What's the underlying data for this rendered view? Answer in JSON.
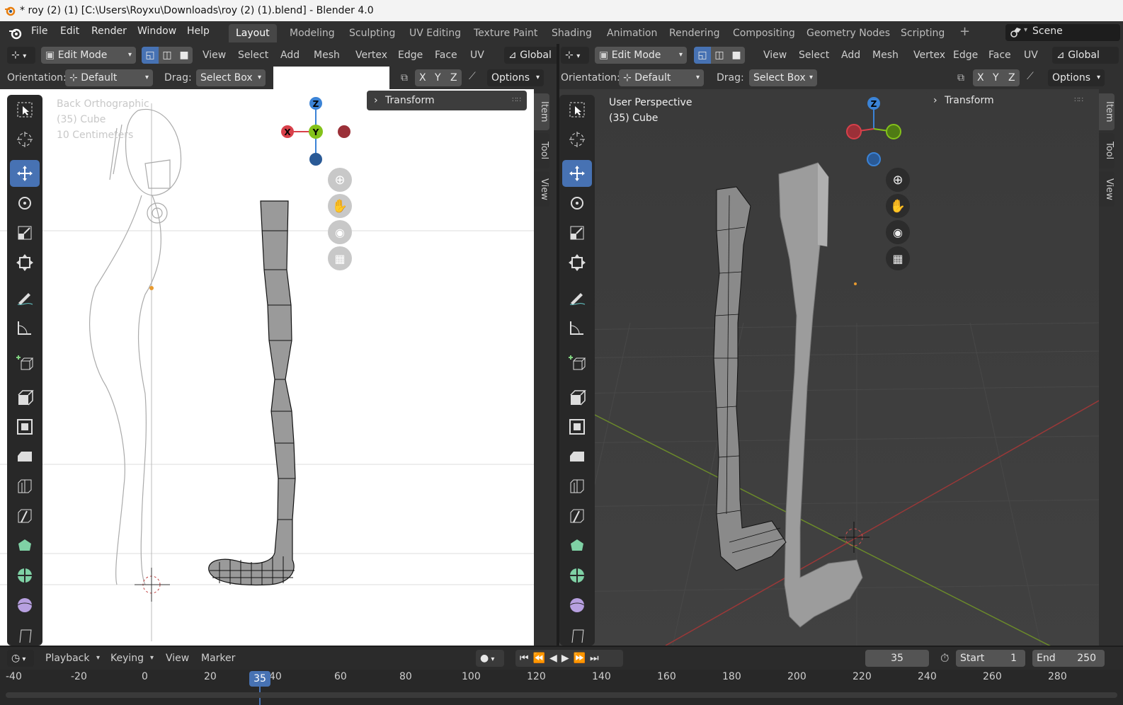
{
  "titlebar": {
    "title": "* roy (2) (1) [C:\\Users\\Royxu\\Downloads\\roy (2) (1).blend] - Blender 4.0"
  },
  "menubar": {
    "menus": [
      "File",
      "Edit",
      "Render",
      "Window",
      "Help"
    ],
    "workspaces": [
      "Layout",
      "Modeling",
      "Sculpting",
      "UV Editing",
      "Texture Paint",
      "Shading",
      "Animation",
      "Rendering",
      "Compositing",
      "Geometry Nodes",
      "Scripting"
    ],
    "active_workspace": "Layout",
    "add_tab": "+",
    "scene_label": "Scene"
  },
  "left_view": {
    "mode": "Edit Mode",
    "menus": [
      "View",
      "Select",
      "Add",
      "Mesh",
      "Vertex",
      "Edge",
      "Face",
      "UV"
    ],
    "transform_space": "Global",
    "orientation_label": "Orientation:",
    "orientation_value": "Default",
    "drag_label": "Drag:",
    "drag_value": "Select Box",
    "axes": [
      "X",
      "Y",
      "Z"
    ],
    "options_label": "Options",
    "overlay_info": [
      "Back Orthographic",
      "(35) Cube",
      "10 Centimeters"
    ],
    "panel_title": "Transform",
    "side_tabs": [
      "Item",
      "Tool",
      "View"
    ],
    "gizmo": {
      "z": "Z",
      "x": "X",
      "y": "Y"
    }
  },
  "right_view": {
    "mode": "Edit Mode",
    "menus": [
      "View",
      "Select",
      "Add",
      "Mesh",
      "Vertex",
      "Edge",
      "Face",
      "UV"
    ],
    "transform_space": "Global",
    "orientation_label": "Orientation:",
    "orientation_value": "Default",
    "drag_label": "Drag:",
    "drag_value": "Select Box",
    "axes": [
      "X",
      "Y",
      "Z"
    ],
    "options_label": "Options",
    "overlay_info": [
      "User Perspective",
      "(35) Cube"
    ],
    "panel_title": "Transform",
    "side_tabs": [
      "Item",
      "Tool",
      "View"
    ],
    "gizmo": {
      "z": "Z"
    }
  },
  "timeline": {
    "menus": [
      "Playback",
      "Keying",
      "View",
      "Marker"
    ],
    "current_frame": "35",
    "start_label": "Start",
    "start_value": "1",
    "end_label": "End",
    "end_value": "250",
    "ruler": [
      "-40",
      "-20",
      "0",
      "20",
      "40",
      "60",
      "80",
      "100",
      "120",
      "140",
      "160",
      "180",
      "200",
      "220",
      "240",
      "260",
      "280"
    ],
    "playhead": "35"
  },
  "colors": {
    "accent": "#4772b3",
    "x_axis": "#d8404a",
    "y_axis": "#84c21a",
    "z_axis": "#3b83d6"
  }
}
